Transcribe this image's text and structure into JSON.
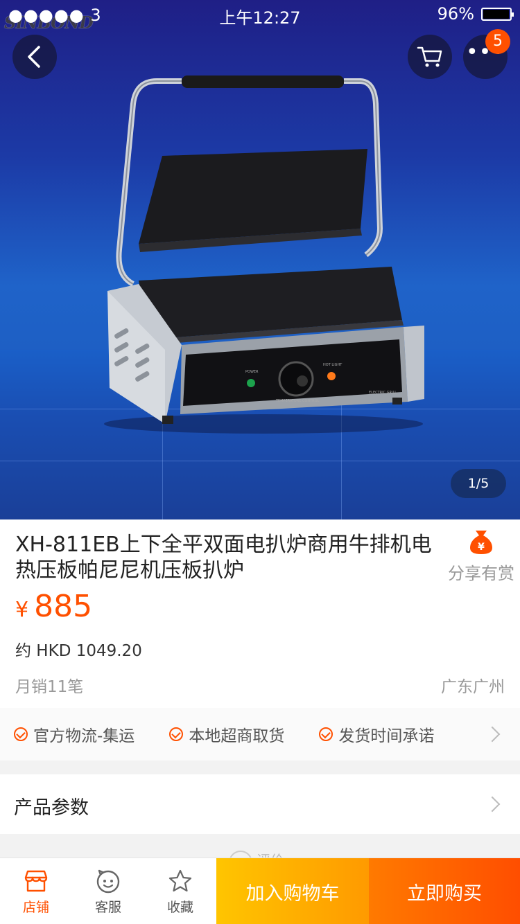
{
  "status_bar": {
    "signal": "●●●●● 3",
    "time": "上午12:27",
    "battery": "96%"
  },
  "hero": {
    "brand": "SINBOND",
    "page_indicator": "1/5",
    "more_badge": "5",
    "panel_labels": {
      "power": "POWER",
      "hot_light": "HOT LIGHT",
      "temperature": "TEMPERATURE CONTROL",
      "model": "ELECTRIC GRILL"
    }
  },
  "product": {
    "title": "XH-811EB上下全平双面电扒炉商用牛排机电热压板帕尼尼机压板扒炉",
    "share_label": "分享有赏",
    "currency": "¥",
    "price": "885",
    "approx_price": "约 HKD 1049.20",
    "monthly_sales": "月销11笔",
    "location": "广东广州"
  },
  "services": [
    {
      "label": "官方物流-集运"
    },
    {
      "label": "本地超商取货"
    },
    {
      "label": "发货时间承诺"
    }
  ],
  "params": {
    "label": "产品参数"
  },
  "rating_peek": {
    "label": "评价"
  },
  "bottom_bar": {
    "tabs": [
      {
        "label": "店铺",
        "icon": "shop-icon"
      },
      {
        "label": "客服",
        "icon": "customer-service-icon"
      },
      {
        "label": "收藏",
        "icon": "star-icon"
      }
    ],
    "add_to_cart": "加入购物车",
    "buy_now": "立即购买"
  },
  "colors": {
    "accent": "#ff5000",
    "cart_button": "#ffb000",
    "buy_button": "#ff5a00"
  }
}
